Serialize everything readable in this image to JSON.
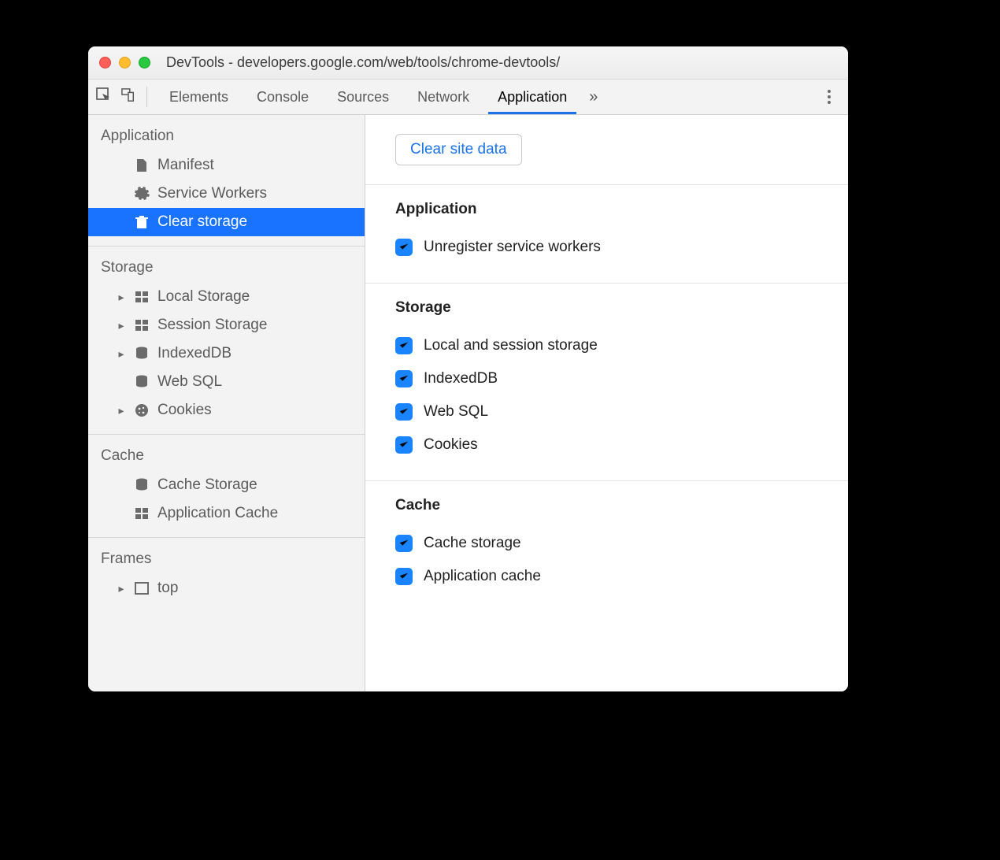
{
  "window": {
    "title": "DevTools - developers.google.com/web/tools/chrome-devtools/"
  },
  "tabs": {
    "items": [
      "Elements",
      "Console",
      "Sources",
      "Network",
      "Application"
    ],
    "active": "Application"
  },
  "sidebar": {
    "sections": [
      {
        "title": "Application",
        "items": [
          {
            "icon": "file",
            "label": "Manifest",
            "expandable": false,
            "selected": false
          },
          {
            "icon": "gear",
            "label": "Service Workers",
            "expandable": false,
            "selected": false
          },
          {
            "icon": "trash",
            "label": "Clear storage",
            "expandable": false,
            "selected": true
          }
        ]
      },
      {
        "title": "Storage",
        "items": [
          {
            "icon": "grid",
            "label": "Local Storage",
            "expandable": true,
            "selected": false
          },
          {
            "icon": "grid",
            "label": "Session Storage",
            "expandable": true,
            "selected": false
          },
          {
            "icon": "db",
            "label": "IndexedDB",
            "expandable": true,
            "selected": false
          },
          {
            "icon": "db",
            "label": "Web SQL",
            "expandable": false,
            "selected": false
          },
          {
            "icon": "cookie",
            "label": "Cookies",
            "expandable": true,
            "selected": false
          }
        ]
      },
      {
        "title": "Cache",
        "items": [
          {
            "icon": "db",
            "label": "Cache Storage",
            "expandable": false,
            "selected": false
          },
          {
            "icon": "grid",
            "label": "Application Cache",
            "expandable": false,
            "selected": false
          }
        ]
      },
      {
        "title": "Frames",
        "items": [
          {
            "icon": "frame",
            "label": "top",
            "expandable": true,
            "selected": false
          }
        ]
      }
    ]
  },
  "main": {
    "clear_button": "Clear site data",
    "groups": [
      {
        "title": "Application",
        "checks": [
          {
            "label": "Unregister service workers",
            "checked": true
          }
        ]
      },
      {
        "title": "Storage",
        "checks": [
          {
            "label": "Local and session storage",
            "checked": true
          },
          {
            "label": "IndexedDB",
            "checked": true
          },
          {
            "label": "Web SQL",
            "checked": true
          },
          {
            "label": "Cookies",
            "checked": true
          }
        ]
      },
      {
        "title": "Cache",
        "checks": [
          {
            "label": "Cache storage",
            "checked": true
          },
          {
            "label": "Application cache",
            "checked": true
          }
        ]
      }
    ]
  }
}
